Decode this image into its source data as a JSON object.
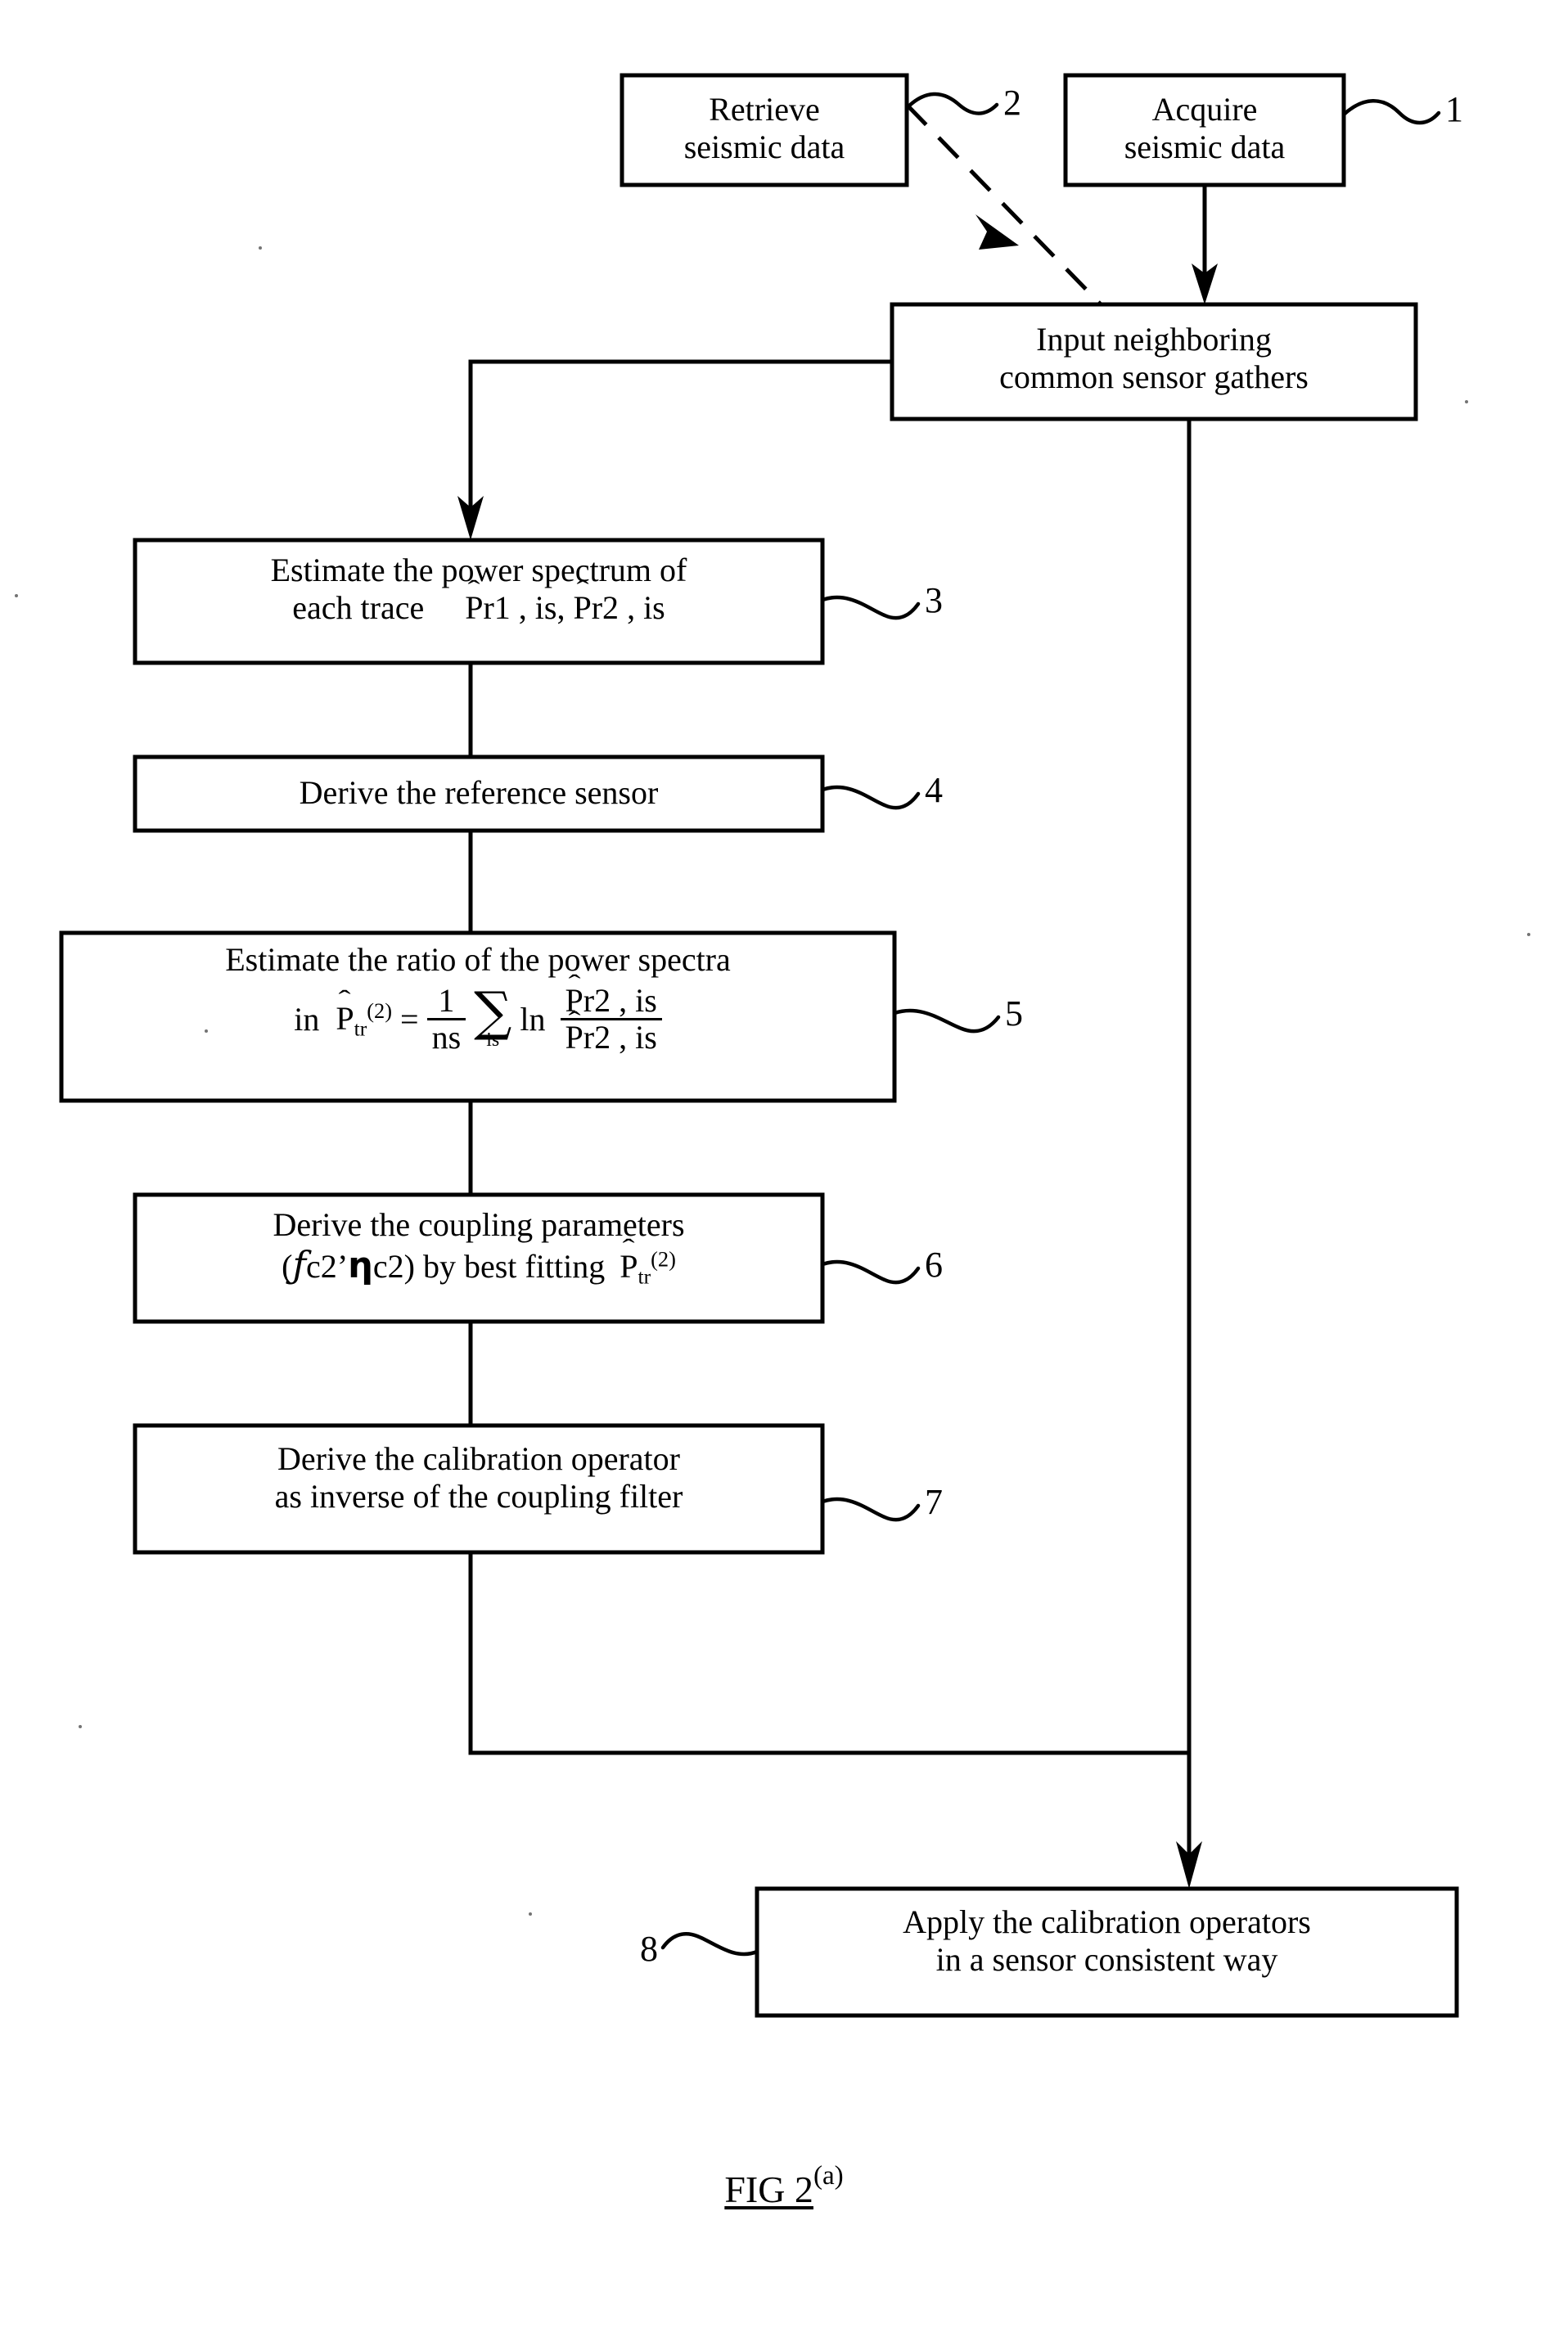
{
  "figure": {
    "caption_main": "FIG 2",
    "caption_sup": "(a)",
    "title": "FIG 2(a)"
  },
  "boxes": [
    {
      "id": "retrieve-seismic-data",
      "ref": "2",
      "line1": "Retrieve",
      "line2": "seismic data"
    },
    {
      "id": "acquire-seismic-data",
      "ref": "1",
      "line1": "Acquire",
      "line2": "seismic data"
    },
    {
      "id": "input-common-sensor-gathers",
      "ref": "",
      "line1": "Input neighboring",
      "line2": "common sensor gathers"
    },
    {
      "id": "estimate-power-spectrum",
      "ref": "3",
      "line1": "Estimate the power spectrum of",
      "line2_prefix": "each trace",
      "line2_math": "P̂r1 , is , P̂r2 , is"
    },
    {
      "id": "derive-reference-sensor",
      "ref": "4",
      "line1": "Derive the reference sensor"
    },
    {
      "id": "estimate-ratio-power-spectra",
      "ref": "5",
      "line1": "Estimate the ratio of the power spectra",
      "line2_prefix": "in",
      "formula": {
        "lhs": "P̂tr(2)",
        "equals": "=",
        "coefficient_num": "1",
        "coefficient_den": "ns",
        "sum_symbol": "∑",
        "sum_index": "is",
        "log": "ln",
        "ratio_num": "P̂r2 , is",
        "ratio_den": "P̂r2 , is"
      }
    },
    {
      "id": "derive-coupling-parameters",
      "ref": "6",
      "line1": "Derive the coupling parameters",
      "line2_params_open": "(",
      "line2_param1": "ƒc2",
      "line2_comma": "’",
      "line2_param2": "ηc2",
      "line2_params_close": ")",
      "line2_rest": "by best fitting",
      "line2_math": "P̂tr(2)"
    },
    {
      "id": "derive-calibration-operator",
      "ref": "7",
      "line1": "Derive the calibration operator",
      "line2": "as inverse of the coupling filter"
    },
    {
      "id": "apply-calibration-operators",
      "ref": "8",
      "line1": "Apply the calibration operators",
      "line2": "in a sensor consistent way"
    }
  ],
  "symbols": {
    "hat": "̂",
    "hat_glyph": "ˆ",
    "sigma": "∑",
    "eta": "η",
    "script_f": "ƒ",
    "p": "P",
    "sub_tr": "tr",
    "sub_c2": "c2",
    "sub_is": "is",
    "sup_2": "(2)",
    "r1": "r1",
    "r2": "r2",
    "is": "is",
    "ns": "ns",
    "one": "1",
    "ln": "ln",
    "equals": "=",
    "comma": ","
  },
  "reference_numerals": [
    "1",
    "2",
    "3",
    "4",
    "5",
    "6",
    "7",
    "8"
  ],
  "colors": {
    "ink": "#000000",
    "paper": "#ffffff"
  }
}
